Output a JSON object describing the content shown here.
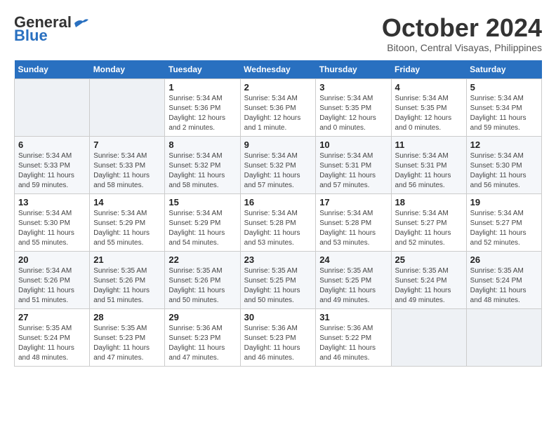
{
  "header": {
    "logo_line1": "General",
    "logo_line2": "Blue",
    "month": "October 2024",
    "location": "Bitoon, Central Visayas, Philippines"
  },
  "weekdays": [
    "Sunday",
    "Monday",
    "Tuesday",
    "Wednesday",
    "Thursday",
    "Friday",
    "Saturday"
  ],
  "weeks": [
    [
      {
        "day": "",
        "info": ""
      },
      {
        "day": "",
        "info": ""
      },
      {
        "day": "1",
        "info": "Sunrise: 5:34 AM\nSunset: 5:36 PM\nDaylight: 12 hours\nand 2 minutes."
      },
      {
        "day": "2",
        "info": "Sunrise: 5:34 AM\nSunset: 5:36 PM\nDaylight: 12 hours\nand 1 minute."
      },
      {
        "day": "3",
        "info": "Sunrise: 5:34 AM\nSunset: 5:35 PM\nDaylight: 12 hours\nand 0 minutes."
      },
      {
        "day": "4",
        "info": "Sunrise: 5:34 AM\nSunset: 5:35 PM\nDaylight: 12 hours\nand 0 minutes."
      },
      {
        "day": "5",
        "info": "Sunrise: 5:34 AM\nSunset: 5:34 PM\nDaylight: 11 hours\nand 59 minutes."
      }
    ],
    [
      {
        "day": "6",
        "info": "Sunrise: 5:34 AM\nSunset: 5:33 PM\nDaylight: 11 hours\nand 59 minutes."
      },
      {
        "day": "7",
        "info": "Sunrise: 5:34 AM\nSunset: 5:33 PM\nDaylight: 11 hours\nand 58 minutes."
      },
      {
        "day": "8",
        "info": "Sunrise: 5:34 AM\nSunset: 5:32 PM\nDaylight: 11 hours\nand 58 minutes."
      },
      {
        "day": "9",
        "info": "Sunrise: 5:34 AM\nSunset: 5:32 PM\nDaylight: 11 hours\nand 57 minutes."
      },
      {
        "day": "10",
        "info": "Sunrise: 5:34 AM\nSunset: 5:31 PM\nDaylight: 11 hours\nand 57 minutes."
      },
      {
        "day": "11",
        "info": "Sunrise: 5:34 AM\nSunset: 5:31 PM\nDaylight: 11 hours\nand 56 minutes."
      },
      {
        "day": "12",
        "info": "Sunrise: 5:34 AM\nSunset: 5:30 PM\nDaylight: 11 hours\nand 56 minutes."
      }
    ],
    [
      {
        "day": "13",
        "info": "Sunrise: 5:34 AM\nSunset: 5:30 PM\nDaylight: 11 hours\nand 55 minutes."
      },
      {
        "day": "14",
        "info": "Sunrise: 5:34 AM\nSunset: 5:29 PM\nDaylight: 11 hours\nand 55 minutes."
      },
      {
        "day": "15",
        "info": "Sunrise: 5:34 AM\nSunset: 5:29 PM\nDaylight: 11 hours\nand 54 minutes."
      },
      {
        "day": "16",
        "info": "Sunrise: 5:34 AM\nSunset: 5:28 PM\nDaylight: 11 hours\nand 53 minutes."
      },
      {
        "day": "17",
        "info": "Sunrise: 5:34 AM\nSunset: 5:28 PM\nDaylight: 11 hours\nand 53 minutes."
      },
      {
        "day": "18",
        "info": "Sunrise: 5:34 AM\nSunset: 5:27 PM\nDaylight: 11 hours\nand 52 minutes."
      },
      {
        "day": "19",
        "info": "Sunrise: 5:34 AM\nSunset: 5:27 PM\nDaylight: 11 hours\nand 52 minutes."
      }
    ],
    [
      {
        "day": "20",
        "info": "Sunrise: 5:34 AM\nSunset: 5:26 PM\nDaylight: 11 hours\nand 51 minutes."
      },
      {
        "day": "21",
        "info": "Sunrise: 5:35 AM\nSunset: 5:26 PM\nDaylight: 11 hours\nand 51 minutes."
      },
      {
        "day": "22",
        "info": "Sunrise: 5:35 AM\nSunset: 5:26 PM\nDaylight: 11 hours\nand 50 minutes."
      },
      {
        "day": "23",
        "info": "Sunrise: 5:35 AM\nSunset: 5:25 PM\nDaylight: 11 hours\nand 50 minutes."
      },
      {
        "day": "24",
        "info": "Sunrise: 5:35 AM\nSunset: 5:25 PM\nDaylight: 11 hours\nand 49 minutes."
      },
      {
        "day": "25",
        "info": "Sunrise: 5:35 AM\nSunset: 5:24 PM\nDaylight: 11 hours\nand 49 minutes."
      },
      {
        "day": "26",
        "info": "Sunrise: 5:35 AM\nSunset: 5:24 PM\nDaylight: 11 hours\nand 48 minutes."
      }
    ],
    [
      {
        "day": "27",
        "info": "Sunrise: 5:35 AM\nSunset: 5:24 PM\nDaylight: 11 hours\nand 48 minutes."
      },
      {
        "day": "28",
        "info": "Sunrise: 5:35 AM\nSunset: 5:23 PM\nDaylight: 11 hours\nand 47 minutes."
      },
      {
        "day": "29",
        "info": "Sunrise: 5:36 AM\nSunset: 5:23 PM\nDaylight: 11 hours\nand 47 minutes."
      },
      {
        "day": "30",
        "info": "Sunrise: 5:36 AM\nSunset: 5:23 PM\nDaylight: 11 hours\nand 46 minutes."
      },
      {
        "day": "31",
        "info": "Sunrise: 5:36 AM\nSunset: 5:22 PM\nDaylight: 11 hours\nand 46 minutes."
      },
      {
        "day": "",
        "info": ""
      },
      {
        "day": "",
        "info": ""
      }
    ]
  ]
}
